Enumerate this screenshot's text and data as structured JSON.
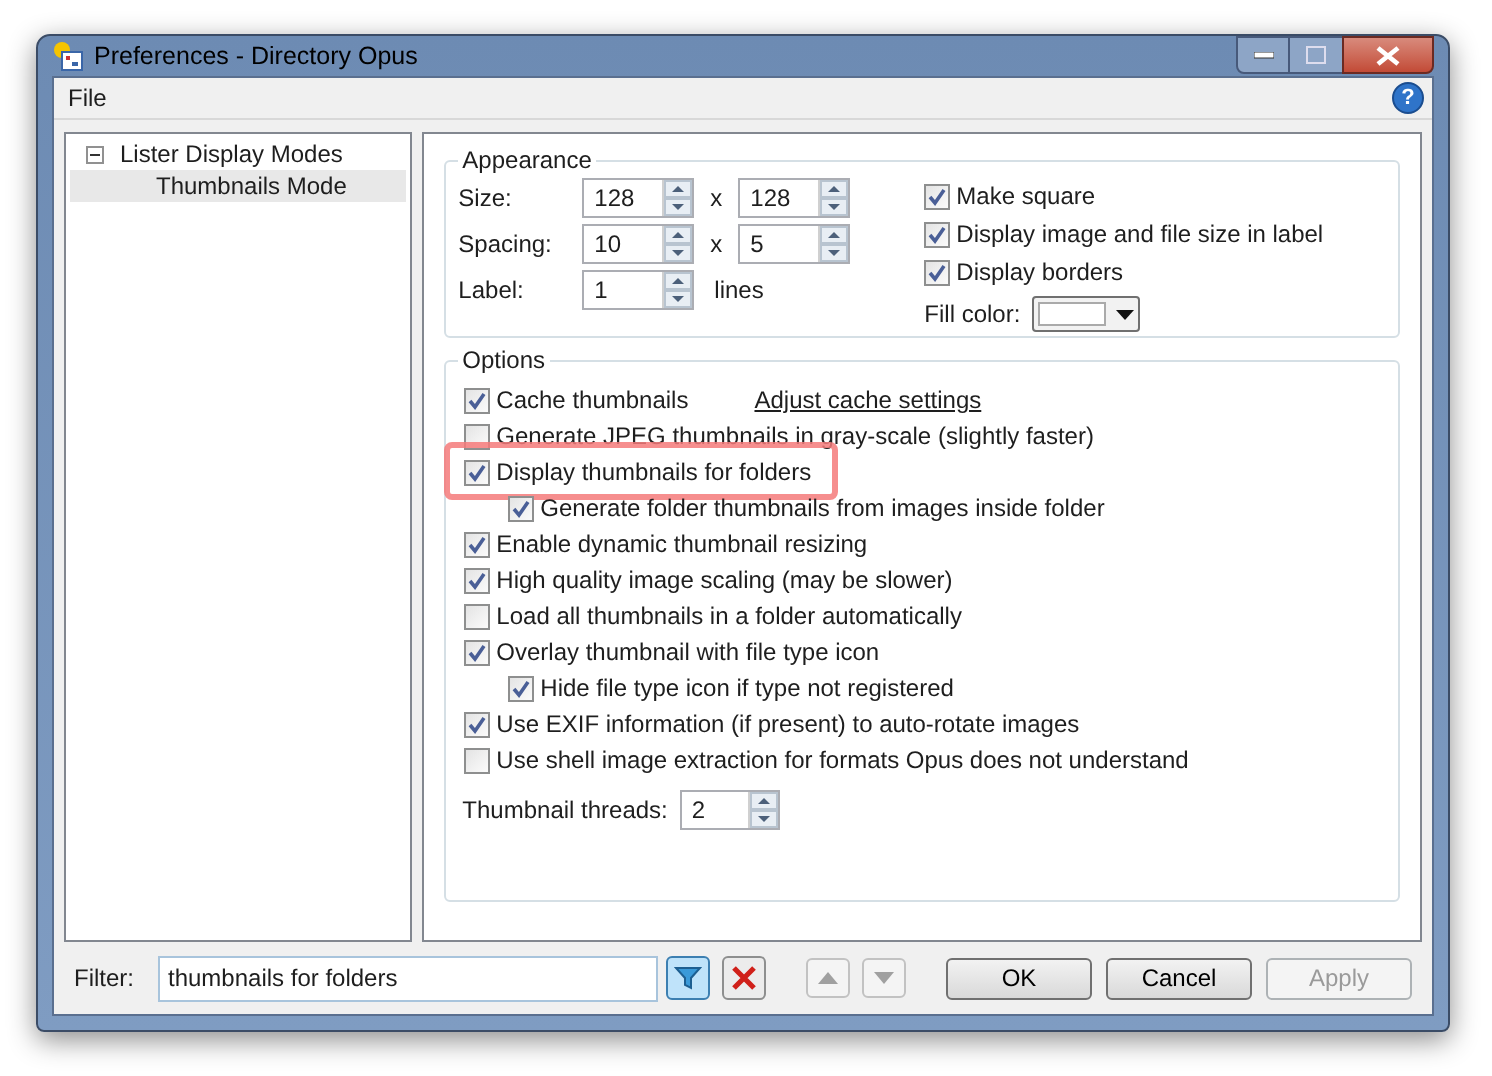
{
  "window": {
    "title": "Preferences - Directory Opus"
  },
  "menu": [
    "File"
  ],
  "help": {
    "label": "?"
  },
  "tree": [
    {
      "label": "Lister Display Modes",
      "expanded": true,
      "selected": false,
      "children": [
        {
          "label": "Thumbnails Mode",
          "selected": true
        }
      ]
    }
  ],
  "appearance": {
    "title": "Appearance",
    "rows": [
      {
        "label": "Size:",
        "value1": "128",
        "sep": "x",
        "value2": "128"
      },
      {
        "label": "Spacing:",
        "value1": "10",
        "sep": "x",
        "value2": "5"
      },
      {
        "label": "Label:",
        "value1": "1",
        "suffix": "lines"
      }
    ],
    "checks": [
      {
        "label": "Make square",
        "checked": true
      },
      {
        "label": "Display image and file size in label",
        "checked": true
      },
      {
        "label": "Display borders",
        "checked": true
      }
    ],
    "fill_color": {
      "label": "Fill color:",
      "color": "#ffffff"
    }
  },
  "options": {
    "title": "Options",
    "items": [
      {
        "label": "Cache thumbnails",
        "checked": true,
        "highlighted": false,
        "link": "Adjust cache settings"
      },
      {
        "label": "Generate JPEG thumbnails in gray-scale (slightly faster)",
        "checked": false,
        "highlighted": false
      },
      {
        "label": "Display thumbnails for folders",
        "checked": true,
        "highlighted": true,
        "children": [
          {
            "label": "Generate folder thumbnails from images inside folder",
            "checked": true,
            "highlighted": false
          }
        ]
      },
      {
        "label": "Enable dynamic thumbnail resizing",
        "checked": true,
        "highlighted": false
      },
      {
        "label": "High quality image scaling (may be slower)",
        "checked": true,
        "highlighted": false
      },
      {
        "label": "Load all thumbnails in a folder automatically",
        "checked": false,
        "highlighted": false
      },
      {
        "label": "Overlay thumbnail with file type icon",
        "checked": true,
        "highlighted": false,
        "children": [
          {
            "label": "Hide file type icon if type not registered",
            "checked": true,
            "highlighted": false
          }
        ]
      },
      {
        "label": "Use EXIF information (if present) to auto-rotate images",
        "checked": true,
        "highlighted": false
      },
      {
        "label": "Use shell image extraction for formats Opus does not understand",
        "checked": false,
        "highlighted": false
      }
    ],
    "threads": {
      "label": "Thumbnail threads:",
      "value": "2"
    }
  },
  "filter": {
    "label": "Filter:",
    "value": "thumbnails for folders"
  },
  "nav_buttons": [
    {
      "kind": "up",
      "disabled": true
    },
    {
      "kind": "down",
      "disabled": true
    }
  ],
  "buttons": [
    {
      "label": "OK",
      "disabled": false
    },
    {
      "label": "Cancel",
      "disabled": false
    },
    {
      "label": "Apply",
      "disabled": true
    }
  ]
}
